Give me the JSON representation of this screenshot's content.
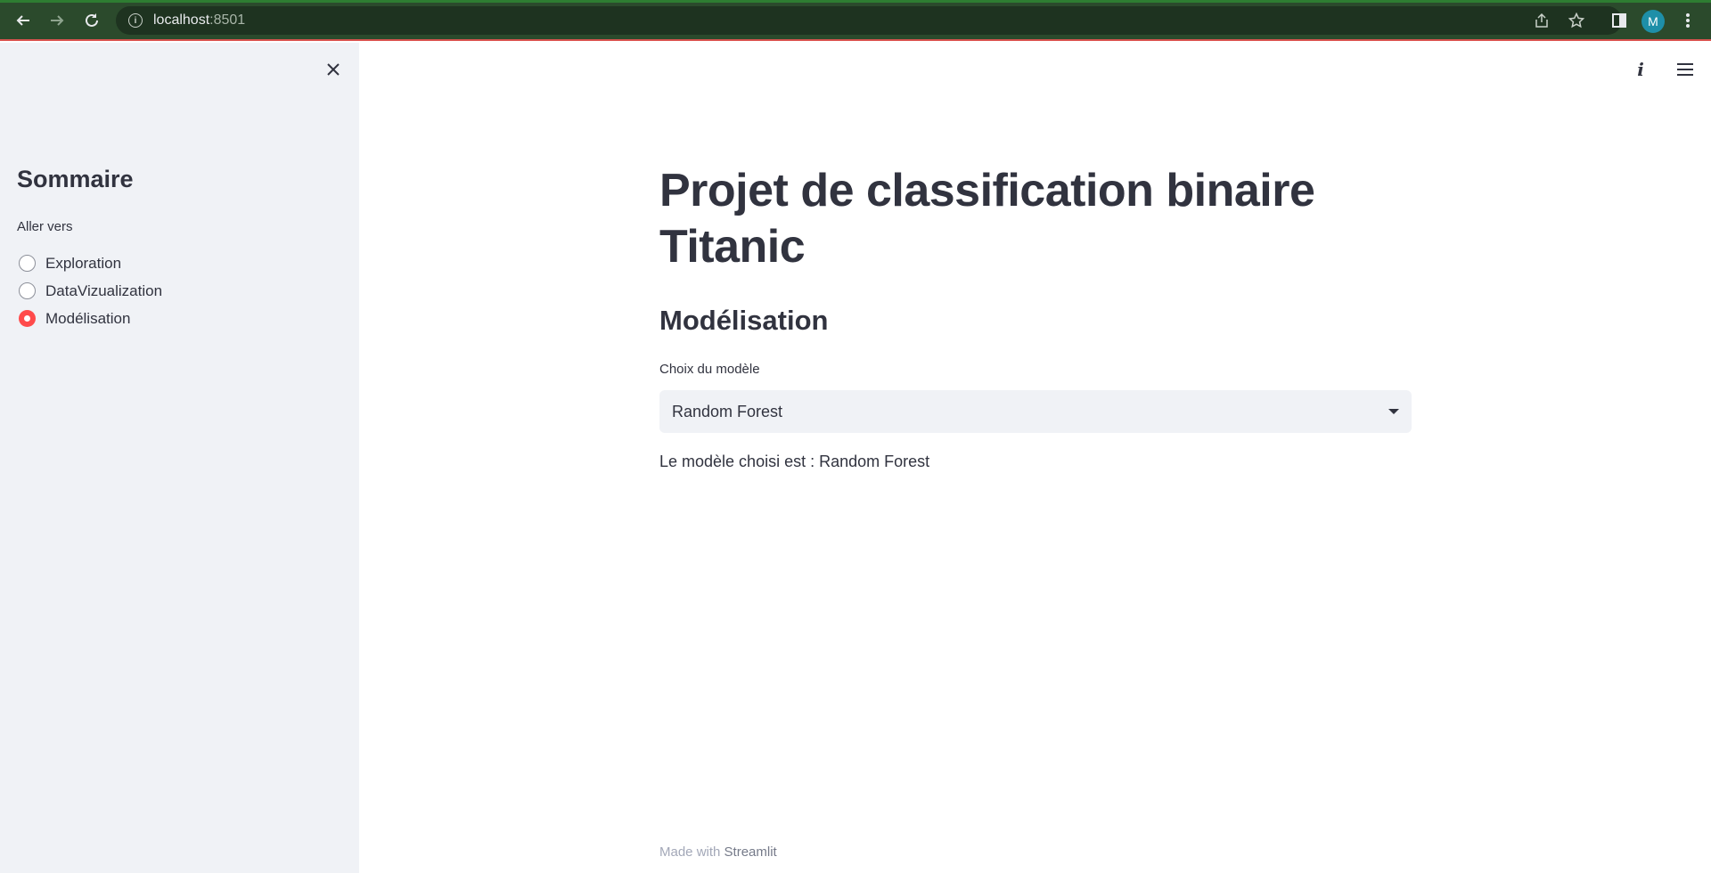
{
  "browser": {
    "url_host": "localhost",
    "url_port": ":8501",
    "profile_initial": "M",
    "chrome_color": "#2b4a2c"
  },
  "sidebar": {
    "title": "Sommaire",
    "radio_label": "Aller vers",
    "options": [
      {
        "label": "Exploration",
        "selected": false
      },
      {
        "label": "DataVizualization",
        "selected": false
      },
      {
        "label": "Modélisation",
        "selected": true
      }
    ],
    "accent_color": "#ff4b4b"
  },
  "main": {
    "title_line1": "Projet de classification binaire",
    "title_line2": "Titanic",
    "section_title": "Modélisation",
    "select_label": "Choix du modèle",
    "select_value": "Random Forest",
    "result_text": "Le modèle choisi est : Random Forest"
  },
  "footer": {
    "prefix": "Made with",
    "link": "Streamlit"
  },
  "icons": {
    "back": "arrow-left-icon",
    "forward": "arrow-right-icon",
    "reload": "reload-icon",
    "info": "info-icon",
    "share": "share-icon",
    "bookmark": "star-icon",
    "side_panel": "side-panel-icon",
    "menu": "kebab-menu-icon",
    "sidebar_close": "close-icon",
    "app_info": "italic-i-icon",
    "app_menu": "hamburger-menu-icon"
  }
}
